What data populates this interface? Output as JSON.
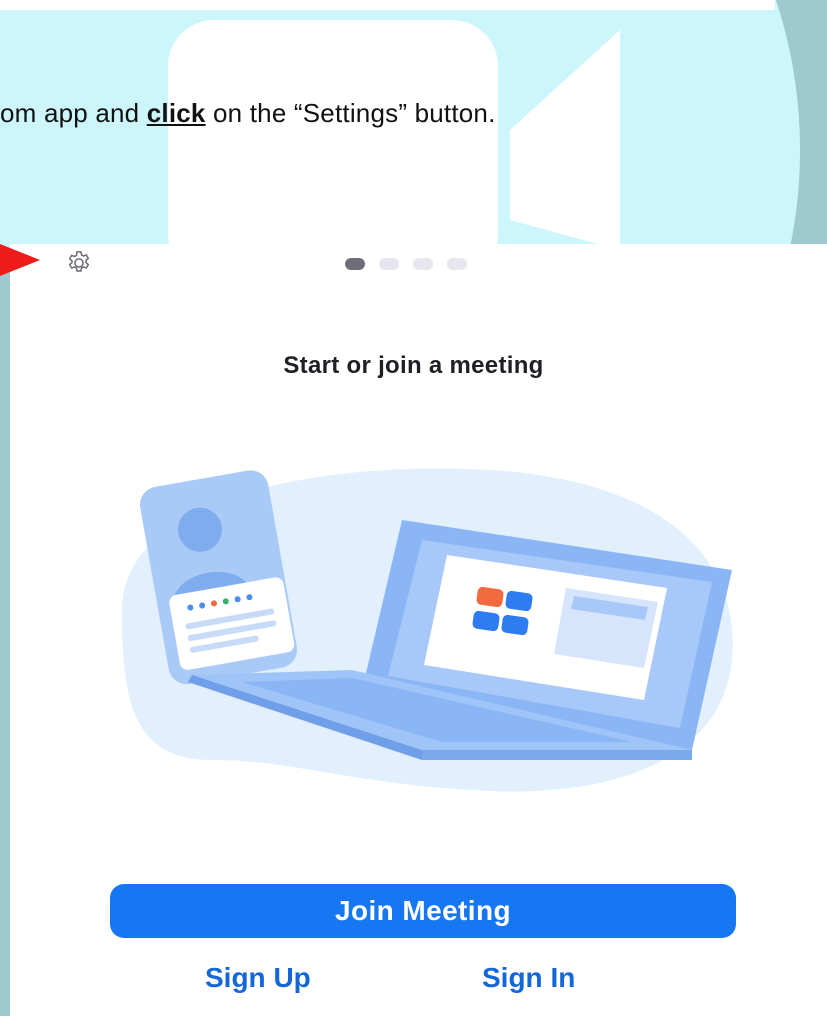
{
  "instruction": {
    "prefix": "om app and ",
    "emphasis": "click",
    "suffix": " on the “Settings” button."
  },
  "icons": {
    "settings": "gear-icon",
    "pointer": "red-arrow-icon"
  },
  "carousel": {
    "total": 4,
    "active": 1
  },
  "headline": "Start or join a meeting",
  "buttons": {
    "join": "Join Meeting",
    "sign_up": "Sign Up",
    "sign_in": "Sign In"
  },
  "colors": {
    "primary": "#1776f2",
    "link": "#1467d9",
    "arrow": "#ee1b1b",
    "backdrop": "#9ec9cf"
  }
}
